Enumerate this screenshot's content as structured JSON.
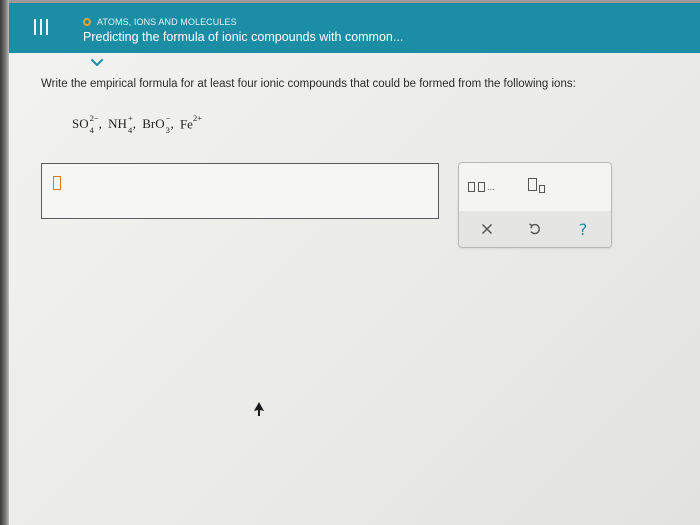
{
  "header": {
    "menu_icon": "hamburger-icon",
    "topic_label": "ATOMS, IONS AND MOLECULES",
    "topic_status_color": "#f0a431",
    "title": "Predicting the formula of ionic compounds with common...",
    "background_color": "#1b8ea6"
  },
  "collapse": {
    "icon": "chevron-down-icon",
    "color": "#1b8ea6"
  },
  "question": {
    "prompt": "Write the empirical formula for at least four ionic compounds that could be formed from the following ions:",
    "ions": [
      {
        "base": "SO",
        "sub": "4",
        "sup": "2−",
        "sep": ","
      },
      {
        "base": "NH",
        "sub": "4",
        "sup": "+",
        "sep": ","
      },
      {
        "base": "BrO",
        "sub": "3",
        "sup": "−",
        "sep": ","
      },
      {
        "base": "Fe",
        "sub": "",
        "sup": "2+",
        "sep": ""
      }
    ]
  },
  "answer": {
    "value": "",
    "cursor_color": "#d97a1f"
  },
  "palette": {
    "multi_box_label": "...",
    "tools": [
      {
        "name": "multiple-answer-tool-icon"
      },
      {
        "name": "subscript-tool-icon"
      }
    ],
    "footer": [
      {
        "name": "clear-icon",
        "glyph": "×"
      },
      {
        "name": "undo-icon",
        "glyph": "↺"
      },
      {
        "name": "help-icon",
        "glyph": "?"
      }
    ],
    "accent_color": "#1d8fa8"
  }
}
